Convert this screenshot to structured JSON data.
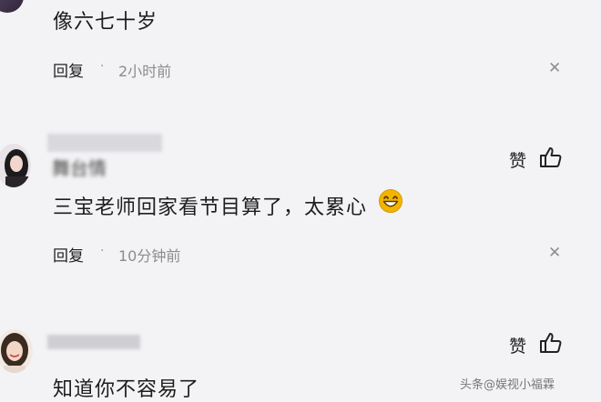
{
  "comments": [
    {
      "text": "像六七十岁",
      "reply_label": "回复",
      "separator": "·",
      "time": "2小时前",
      "close_icon": "close-icon"
    },
    {
      "username": "舞台情",
      "text": "三宝老师回家看节目算了，太累心",
      "emoji": "grinning-face-icon",
      "like_label": "赞",
      "reply_label": "回复",
      "separator": "·",
      "time": "10分钟前",
      "close_icon": "close-icon"
    },
    {
      "like_label": "赞",
      "text": "知道你不容易了"
    }
  ],
  "watermark": "头条@娱视小福霖",
  "colors": {
    "background": "#f3f3f5",
    "text": "#222222",
    "muted": "#8c8c8c",
    "emoji": "#f2b400"
  }
}
